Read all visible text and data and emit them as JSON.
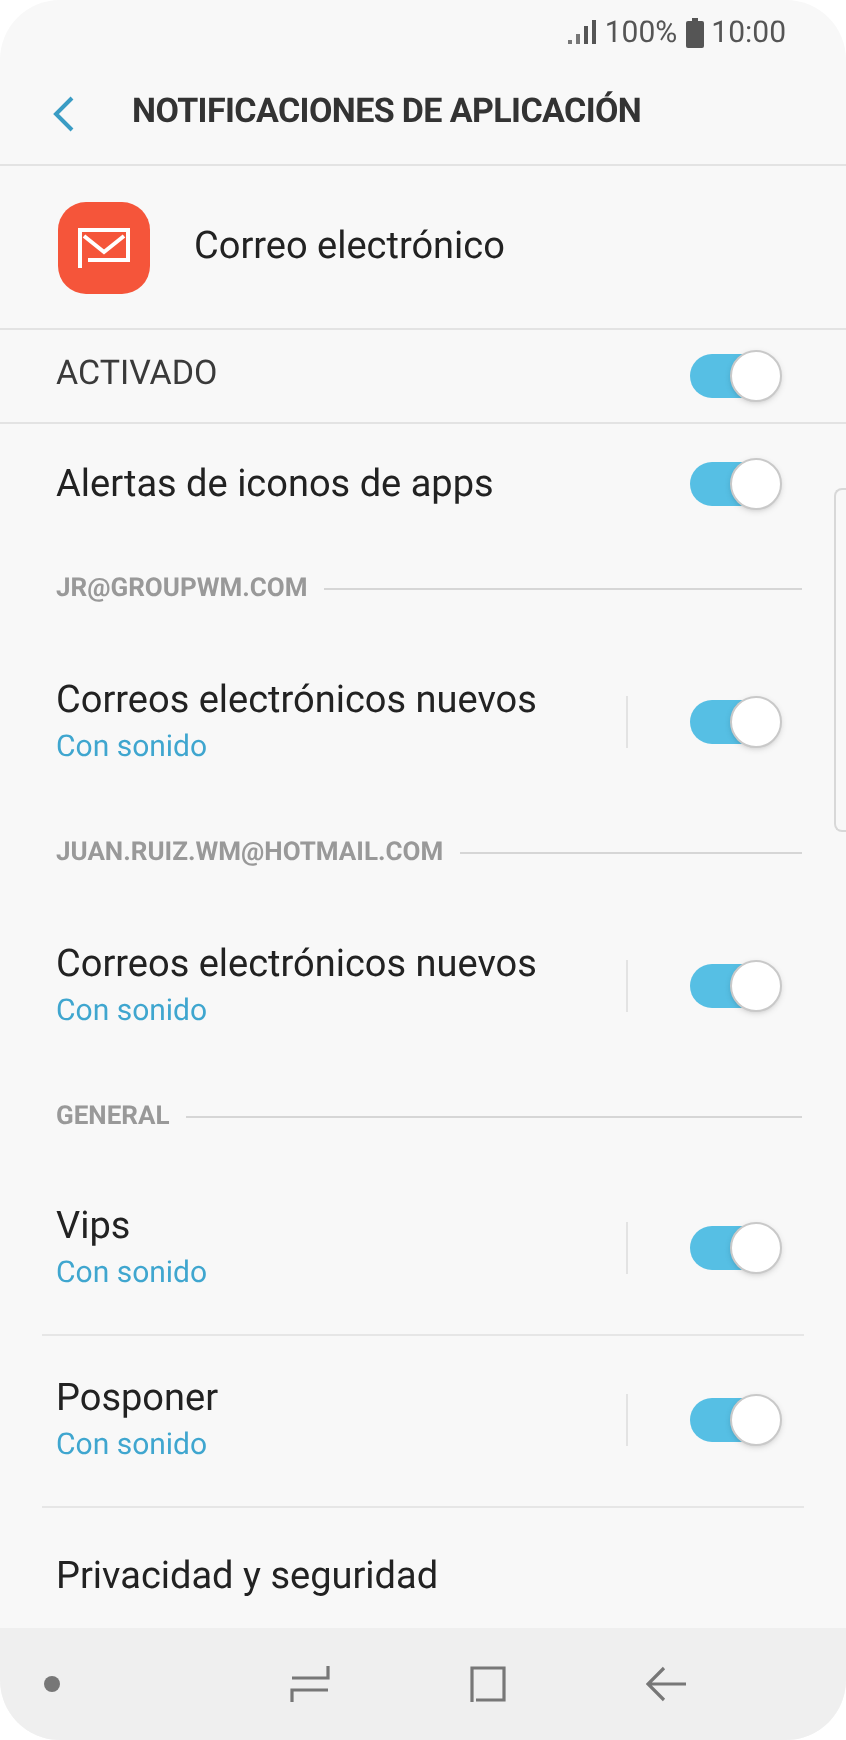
{
  "status_bar": {
    "battery": "100%",
    "time": "10:00"
  },
  "header": {
    "title": "NOTIFICACIONES DE APLICACIÓN"
  },
  "app": {
    "name": "Correo electrónico"
  },
  "items": [
    {
      "kind": "master",
      "label": "ACTIVADO",
      "on": true
    },
    {
      "kind": "toggle",
      "label": "Alertas de iconos de apps",
      "on": true
    },
    {
      "kind": "header",
      "label": "JR@GROUPWM.COM"
    },
    {
      "kind": "sub",
      "label": "Correos electrónicos nuevos",
      "sub": "Con sonido",
      "on": true
    },
    {
      "kind": "header",
      "label": "JUAN.RUIZ.WM@HOTMAIL.COM"
    },
    {
      "kind": "sub",
      "label": "Correos electrónicos nuevos",
      "sub": "Con sonido",
      "on": true
    },
    {
      "kind": "header",
      "label": "GENERAL"
    },
    {
      "kind": "sub",
      "label": "Vips",
      "sub": "Con sonido",
      "on": true,
      "divider": true
    },
    {
      "kind": "sub",
      "label": "Posponer",
      "sub": "Con sonido",
      "on": true,
      "divider": true
    },
    {
      "kind": "cut",
      "label": "Privacidad y seguridad"
    }
  ]
}
